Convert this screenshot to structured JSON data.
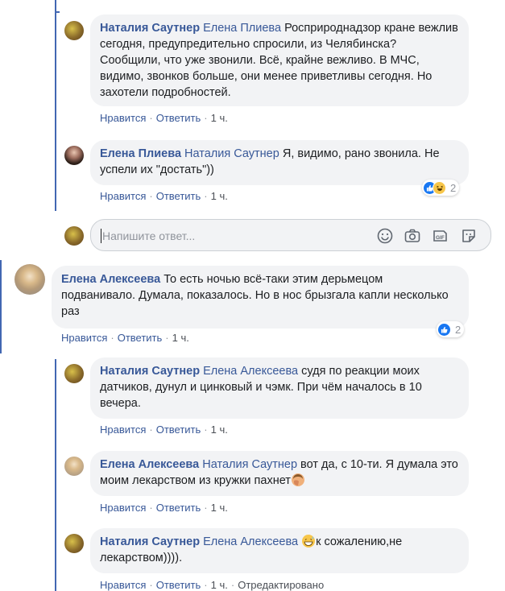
{
  "comments": [
    {
      "author": "Наталия Саутнер",
      "mention": "Елена Плиева",
      "text": " Росприроднадзор кране вежлив сегодня, предупредительно спросили, из Челябинска? Сообщили, что уже звонили. Всё, крайне вежливо. В МЧС, видимо, звонков больше, они менее приветливы сегодня. Но захотели подробностей.",
      "like": "Нравится",
      "reply": "Ответить",
      "time": "1 ч."
    },
    {
      "author": "Елена Плиева",
      "mention": "Наталия Саутнер",
      "text": " Я, видимо, рано звонила. Не успели их \"достать\"))",
      "like": "Нравится",
      "reply": "Ответить",
      "time": "1 ч.",
      "reactions": "2"
    },
    {
      "author": "Елена Алексеева",
      "mention": "",
      "text": " То есть ночью всё-таки этим дерьмецом подванивало. Думала, показалось. Но в нос брызгала капли несколько раз",
      "like": "Нравится",
      "reply": "Ответить",
      "time": "1 ч.",
      "reactions": "2"
    },
    {
      "author": "Наталия Саутнер",
      "mention": "Елена Алексеева",
      "text": " судя по реакции моих датчиков, дунул и цинковый и чэмк. При чём началось в 10 вечера.",
      "like": "Нравится",
      "reply": "Ответить",
      "time": "1 ч."
    },
    {
      "author": "Елена Алексеева",
      "mention": "Наталия Саутнер",
      "text": " вот да, с 10-ти. Я думала это моим лекарством из кружки пахнет",
      "like": "Нравится",
      "reply": "Ответить",
      "time": "1 ч."
    },
    {
      "author": "Наталия Саутнер",
      "mention": "Елена Алексеева",
      "text": "к сожалению,не лекарством)))).",
      "like": "Нравится",
      "reply": "Ответить",
      "time": "1 ч.",
      "edited": "Отредактировано"
    }
  ],
  "composer": {
    "placeholder": "Напишите ответ..."
  },
  "colors": {
    "link": "#385898",
    "bubble": "#f2f3f5",
    "thread_line": "#4267b2",
    "like_blue": "#1877f2"
  },
  "icons": [
    "emoji-icon",
    "camera-icon",
    "gif-icon",
    "sticker-icon"
  ]
}
